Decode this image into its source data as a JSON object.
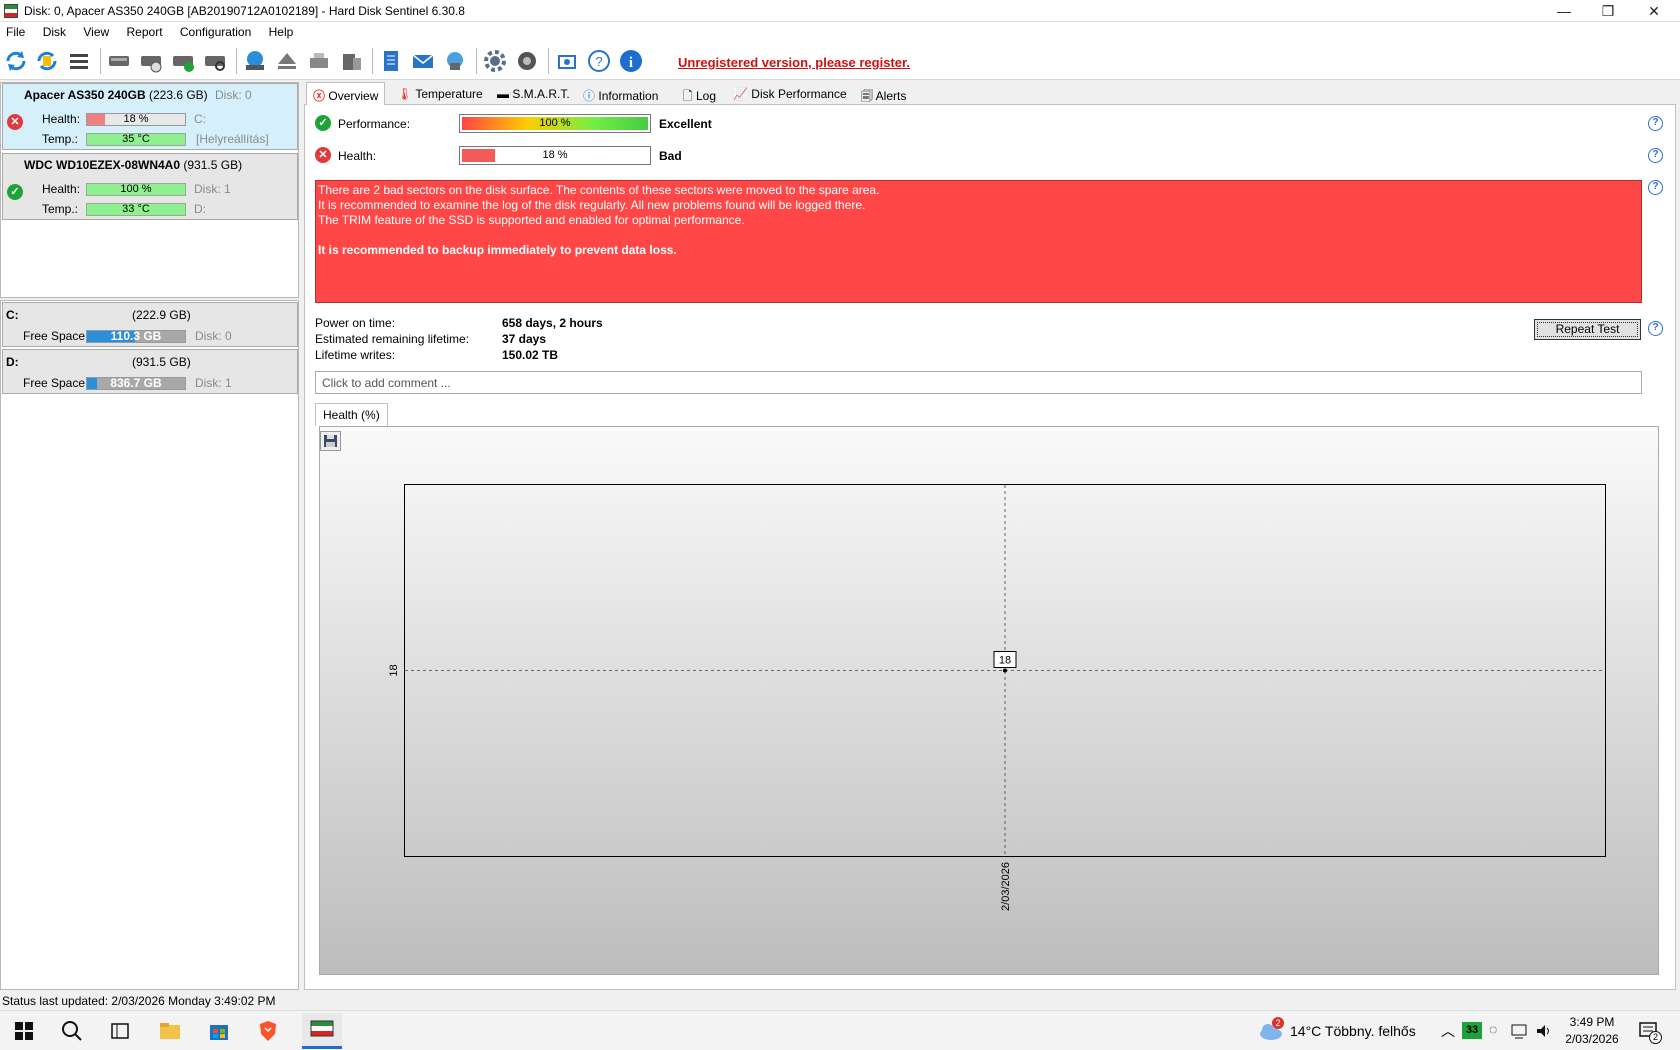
{
  "window": {
    "title": "Disk: 0, Apacer AS350 240GB [AB20190712A0102189]  -  Hard Disk Sentinel 6.30.8",
    "minimize": "—",
    "maximize": "❐",
    "close": "✕"
  },
  "menu": [
    "File",
    "Disk",
    "View",
    "Report",
    "Configuration",
    "Help"
  ],
  "register_link": "Unregistered version, please register.",
  "disks": [
    {
      "name": "Apacer AS350 240GB",
      "size": "(223.6 GB)",
      "disk_label": "Disk: 0",
      "health_label": "Health:",
      "health": "18 %",
      "health_value": 18,
      "volume": "C:",
      "temp_label": "Temp.:",
      "temp": "35 °C",
      "temp_value": 35,
      "extra": "[Helyreállítás]",
      "status": "bad",
      "status_color": "#e23a3a"
    },
    {
      "name": "WDC WD10EZEX-08WN4A0",
      "size": "(931.5 GB)",
      "disk_label": "Disk: 1",
      "health_label": "Health:",
      "health": "100 %",
      "health_value": 100,
      "volume": "D:",
      "temp_label": "Temp.:",
      "temp": "33 °C",
      "temp_value": 33,
      "status": "ok",
      "status_color": "#1ea23a"
    }
  ],
  "volumes": [
    {
      "letter": "C:",
      "size": "(222.9 GB)",
      "free_label": "Free Space",
      "free": "110.3 GB",
      "free_fraction": 0.49,
      "disk": "Disk: 0"
    },
    {
      "letter": "D:",
      "size": "(931.5 GB)",
      "free_label": "Free Space",
      "free": "836.7 GB",
      "free_fraction": 0.1,
      "disk": "Disk: 1"
    }
  ],
  "tabs": [
    "Overview",
    "Temperature",
    "S.M.A.R.T.",
    "Information",
    "Log",
    "Disk Performance",
    "Alerts"
  ],
  "overview": {
    "performance_label": "Performance:",
    "performance": "100 %",
    "performance_value": 100,
    "performance_rating": "Excellent",
    "health_label": "Health:",
    "health": "18 %",
    "health_value": 18,
    "health_rating": "Bad",
    "message_lines": [
      "There are 2 bad sectors on the disk surface. The contents of these sectors were moved to the spare area.",
      "It is recommended to examine the log of the disk regularly. All new problems found will be logged there.",
      "The TRIM feature of the SSD is supported and enabled for optimal performance."
    ],
    "message_bold": "It is recommended to backup immediately to prevent data loss.",
    "power_on_label": "Power on time:",
    "power_on": "658 days, 2 hours",
    "remaining_label": "Estimated remaining lifetime:",
    "remaining": "37 days",
    "writes_label": "Lifetime writes:",
    "writes": "150.02 TB",
    "repeat_button": "Repeat Test",
    "comment_placeholder": "Click to add comment ..."
  },
  "chart_tab": "Health (%)",
  "chart_data": {
    "type": "line",
    "title": "",
    "x": [
      "2/03/2026"
    ],
    "series": [
      {
        "values": [
          18
        ]
      }
    ],
    "ytick_labels": [
      "18"
    ],
    "xtick_labels": [
      "2/03/2026"
    ],
    "data_labels": [
      "18"
    ],
    "grid": true
  },
  "statusbar": "Status last updated: 2/03/2026 Monday 3:49:02 PM",
  "taskbar": {
    "weather_badge": "2",
    "weather": "14°C  Többny. felhős",
    "tray_badge": "33",
    "time": "3:49 PM",
    "date": "2/03/2026",
    "notif_count": "2"
  }
}
